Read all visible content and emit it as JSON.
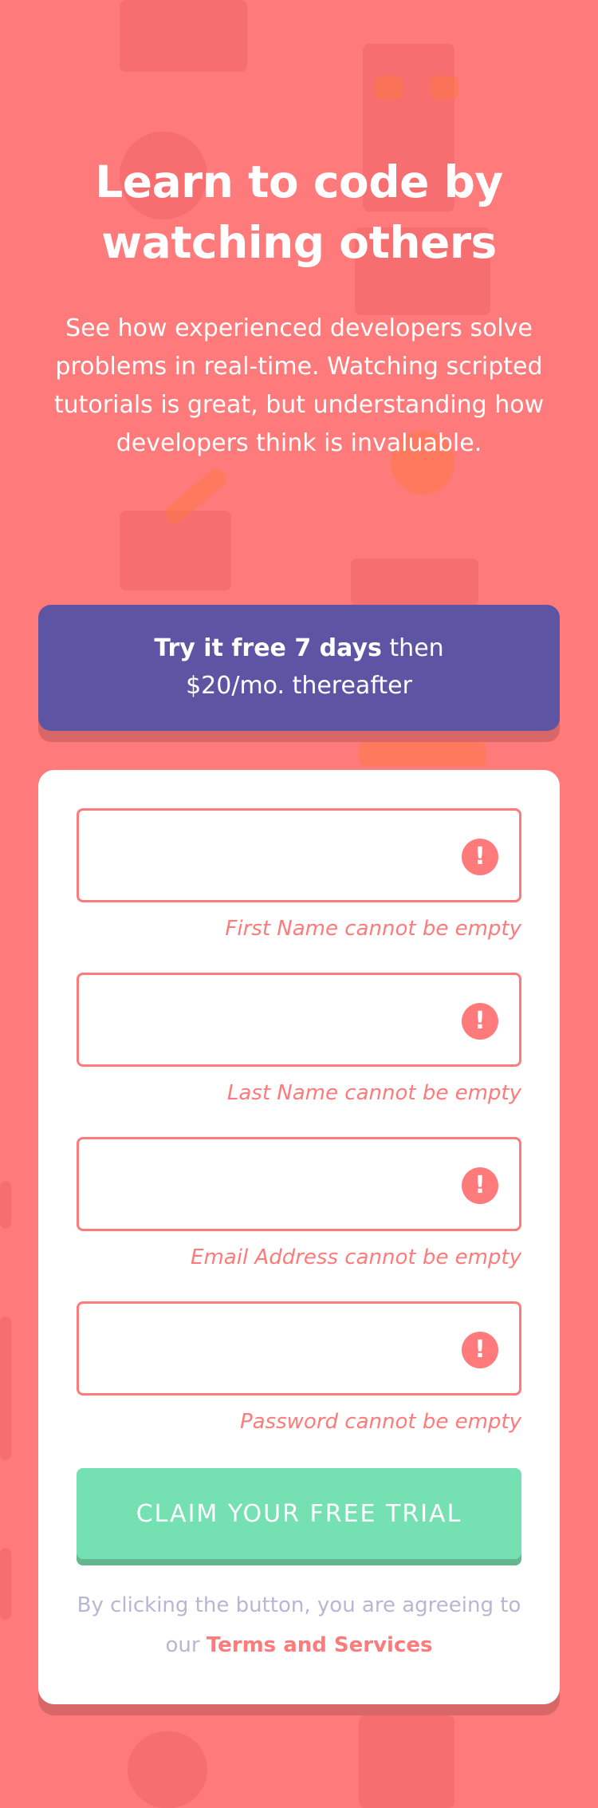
{
  "hero": {
    "headline_line1": "Learn to code by",
    "headline_line2": "watching others",
    "intro": "See how experienced developers solve problems in real-time. Watching scripted tutorials is great, but understanding how developers think is invaluable."
  },
  "promo": {
    "strong": "Try it free 7 days",
    "rest_line1": " then",
    "line2": "$20/mo. thereafter"
  },
  "form": {
    "fields": [
      {
        "value": "",
        "placeholder": "",
        "error": "First Name cannot be empty",
        "icon": "!"
      },
      {
        "value": "",
        "placeholder": "",
        "error": "Last Name cannot be empty",
        "icon": "!"
      },
      {
        "value": "",
        "placeholder": "",
        "error": "Email Address cannot be empty",
        "icon": "!"
      },
      {
        "value": "",
        "placeholder": "",
        "error": "Password cannot be empty",
        "icon": "!"
      }
    ],
    "submit_label": "CLAIM YOUR FREE TRIAL",
    "terms_prefix_1": "By clicking the button, you are agreeing to",
    "terms_prefix_2": "our ",
    "terms_link": "Terms and Services"
  },
  "colors": {
    "background": "#ff7a7a",
    "promo": "#5e54a4",
    "button": "#75e0b1",
    "error": "#ff7a7a",
    "muted_text": "#b9b6d3"
  },
  "icons": {
    "field_error": "error-icon"
  }
}
